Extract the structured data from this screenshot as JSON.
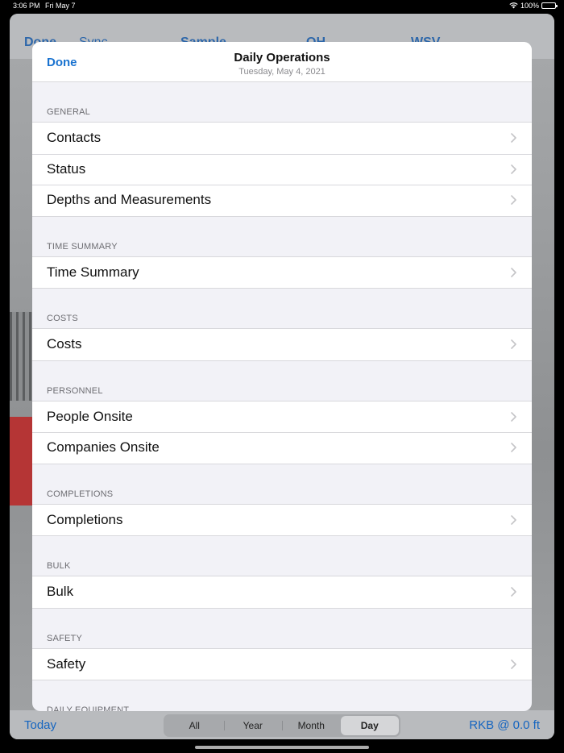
{
  "status_bar": {
    "time": "3:06 PM",
    "date": "Fri May 7",
    "battery": "100%"
  },
  "background_app": {
    "nav_items": [
      "Done",
      "Sync",
      "Sample",
      "OH",
      "WSV"
    ],
    "toolbar": {
      "today": "Today",
      "segments": [
        "All",
        "Year",
        "Month",
        "Day"
      ],
      "selected_segment": "Day",
      "rkb": "RKB @ 0.0 ft"
    }
  },
  "sheet": {
    "done_label": "Done",
    "title": "Daily Operations",
    "subtitle": "Tuesday, May 4, 2021",
    "sections": [
      {
        "header": "GENERAL",
        "items": [
          "Contacts",
          "Status",
          "Depths and Measurements"
        ]
      },
      {
        "header": "TIME SUMMARY",
        "items": [
          "Time Summary"
        ]
      },
      {
        "header": "COSTS",
        "items": [
          "Costs"
        ]
      },
      {
        "header": "PERSONNEL",
        "items": [
          "People Onsite",
          "Companies Onsite"
        ]
      },
      {
        "header": "COMPLETIONS",
        "items": [
          "Completions"
        ]
      },
      {
        "header": "BULK",
        "items": [
          "Bulk"
        ]
      },
      {
        "header": "SAFETY",
        "items": [
          "Safety"
        ]
      },
      {
        "header": "DAILY EQUIPMENT",
        "items": []
      }
    ]
  },
  "colors": {
    "accent": "#1a73d0",
    "toolbar_accent": "#1565c0",
    "chevron": "#c4c4c7"
  },
  "icons": {
    "row_disclosure": "chevron-right-icon",
    "wifi": "wifi-icon",
    "battery": "battery-icon"
  }
}
